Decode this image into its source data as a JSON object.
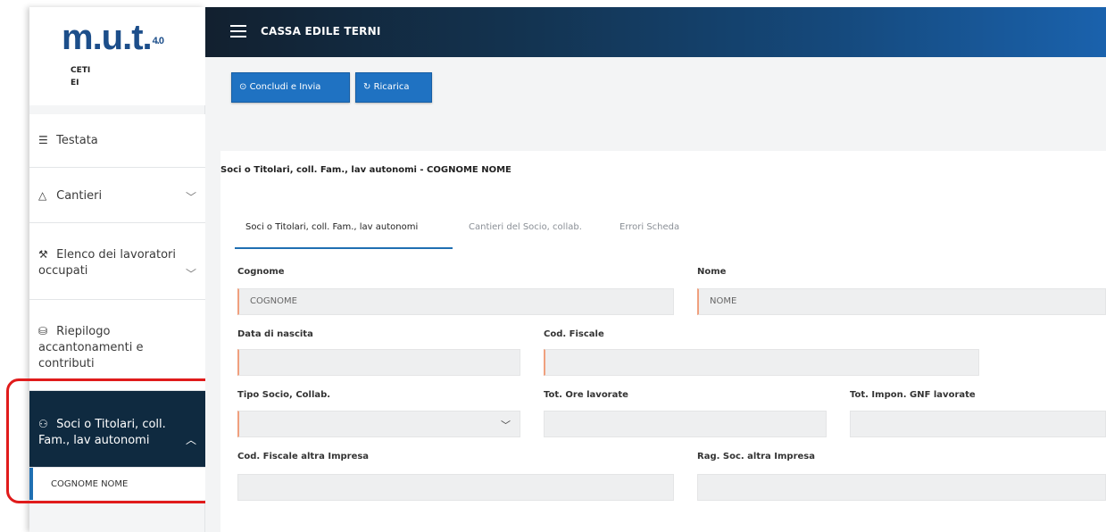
{
  "logo": {
    "text": "m.u.t.",
    "version": "4.0"
  },
  "org": {
    "line1": "CETI",
    "line2": "EI"
  },
  "topbar": {
    "title": "CASSA EDILE TERNI"
  },
  "toolbar": {
    "conclude_label": "Concludi e Invia",
    "reload_label": "Ricarica"
  },
  "sidebar": {
    "items": [
      {
        "label": "Testata"
      },
      {
        "label": "Cantieri"
      },
      {
        "label_line1": "Elenco dei lavoratori",
        "label_line2": "occupati"
      },
      {
        "label_line1": "Riepilogo",
        "label_line2": "accantonamenti e",
        "label_line3": "contributi"
      },
      {
        "label_line1": "Soci o Titolari, coll.",
        "label_line2": "Fam., lav autonomi"
      }
    ],
    "subitem": "COGNOME NOME"
  },
  "panel": {
    "title": "Soci o Titolari, coll. Fam., lav autonomi - COGNOME NOME",
    "tabs": [
      "Soci o Titolari, coll. Fam., lav autonomi",
      "Cantieri del Socio, collab.",
      "Errori Scheda"
    ]
  },
  "form": {
    "cognome": {
      "label": "Cognome",
      "value": "COGNOME"
    },
    "nome": {
      "label": "Nome",
      "value": "NOME"
    },
    "data_nascita": {
      "label": "Data di nascita",
      "value": ""
    },
    "cod_fiscale": {
      "label": "Cod. Fiscale",
      "value": ""
    },
    "tipo_socio": {
      "label": "Tipo Socio, Collab.",
      "value": ""
    },
    "tot_ore": {
      "label": "Tot. Ore lavorate",
      "value": ""
    },
    "tot_impon": {
      "label": "Tot. Impon. GNF lavorate",
      "value": ""
    },
    "cf_altra": {
      "label": "Cod. Fiscale altra Impresa",
      "value": ""
    },
    "rag_soc": {
      "label": "Rag. Soc. altra Impresa",
      "value": ""
    }
  }
}
